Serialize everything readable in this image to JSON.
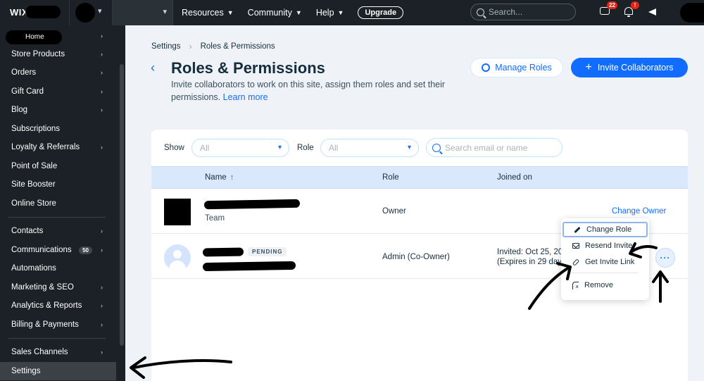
{
  "topbar": {
    "logo": "WIX",
    "nav": [
      {
        "label": "Resources"
      },
      {
        "label": "Community"
      },
      {
        "label": "Help"
      }
    ],
    "upgrade_label": "Upgrade",
    "search_placeholder": "Search...",
    "chat_badge": "22",
    "bell_badge": "!"
  },
  "sidebar": {
    "home_label": "Home",
    "items": [
      {
        "label": "Store Products"
      },
      {
        "label": "Orders"
      },
      {
        "label": "Gift Card"
      },
      {
        "label": "Blog"
      },
      {
        "label": "Subscriptions"
      },
      {
        "label": "Loyalty & Referrals"
      },
      {
        "label": "Point of Sale"
      },
      {
        "label": "Site Booster"
      },
      {
        "label": "Online Store"
      },
      {
        "label": "Contacts"
      },
      {
        "label": "Communications",
        "count": "50"
      },
      {
        "label": "Automations"
      },
      {
        "label": "Marketing & SEO"
      },
      {
        "label": "Analytics & Reports"
      },
      {
        "label": "Billing & Payments"
      },
      {
        "label": "Sales Channels"
      },
      {
        "label": "Settings"
      }
    ]
  },
  "breadcrumb": {
    "parent": "Settings",
    "current": "Roles & Permissions"
  },
  "header": {
    "title": "Roles & Permissions",
    "subtitle": "Invite collaborators to work on this site, assign them roles and set their permissions.",
    "learn_more": "Learn more",
    "manage_roles_label": "Manage Roles",
    "invite_label": "Invite Collaborators"
  },
  "filters": {
    "show_label": "Show",
    "show_value": "All",
    "role_label": "Role",
    "role_value": "All",
    "search_placeholder": "Search email or name"
  },
  "table": {
    "columns": {
      "name": "Name",
      "role": "Role",
      "joined": "Joined on"
    },
    "rows": [
      {
        "subtitle": "Team",
        "role": "Owner",
        "action": "Change Owner"
      },
      {
        "badge": "PENDING",
        "role": "Admin (Co-Owner)",
        "joined_line1": "Invited: Oct 25, 20",
        "joined_line2": "(Expires in 29 days"
      }
    ]
  },
  "menu": {
    "items": [
      {
        "label": "Change Role"
      },
      {
        "label": "Resend Invite"
      },
      {
        "label": "Get Invite Link"
      },
      {
        "label": "Remove"
      }
    ]
  },
  "colors": {
    "accent": "#116dff",
    "topbar_bg": "#1b2126",
    "page_bg": "#eff3f8",
    "table_header_bg": "#dae8fc",
    "badge_red": "#e62214"
  }
}
